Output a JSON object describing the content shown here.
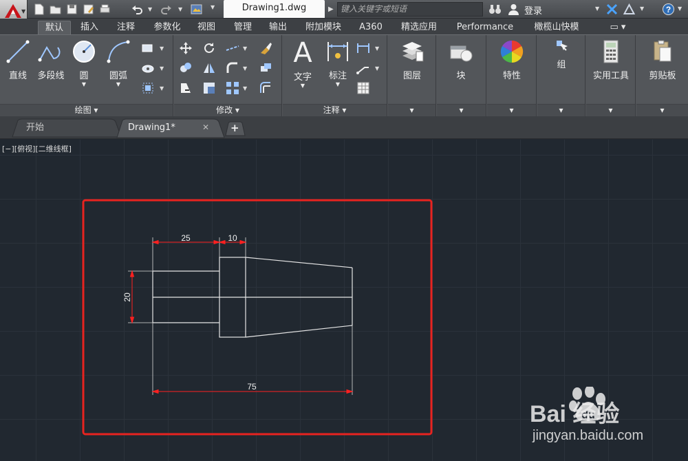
{
  "titlebar": {
    "document_title": "Drawing1.dwg",
    "search_placeholder": "键入关键字或短语",
    "login_label": "登录"
  },
  "ribbon_tabs": [
    {
      "label": "默认",
      "active": true
    },
    {
      "label": "插入"
    },
    {
      "label": "注释"
    },
    {
      "label": "参数化"
    },
    {
      "label": "视图"
    },
    {
      "label": "管理"
    },
    {
      "label": "输出"
    },
    {
      "label": "附加模块"
    },
    {
      "label": "A360"
    },
    {
      "label": "精选应用"
    },
    {
      "label": "Performance"
    },
    {
      "label": "橄榄山快模"
    }
  ],
  "panels": {
    "draw": {
      "title": "绘图",
      "line": "直线",
      "polyline": "多段线",
      "circle": "圆",
      "arc": "圆弧"
    },
    "modify": {
      "title": "修改"
    },
    "annotation": {
      "title": "注释",
      "text": "文字",
      "dimension": "标注"
    },
    "layers": "图层",
    "block": "块",
    "properties": "特性",
    "groups": "组",
    "utilities": "实用工具",
    "clipboard": "剪贴板"
  },
  "doc_tabs": [
    {
      "label": "开始"
    },
    {
      "label": "Drawing1*",
      "active": true
    }
  ],
  "viewport": {
    "label": "[−][俯视][二维线框]"
  },
  "drawing": {
    "dimensions": {
      "top_left": "25",
      "top_right": "10",
      "left_vertical": "20",
      "bottom_total": "75"
    },
    "line_color": "#e6e6e6",
    "dimension_color": "#ff2020",
    "highlight_color": "#e8231f"
  },
  "watermark": {
    "brand": "Bai   经验",
    "url": "jingyan.baidu.com"
  },
  "colors": {
    "canvas_bg": "#212830",
    "ribbon_bg": "#53565a"
  }
}
